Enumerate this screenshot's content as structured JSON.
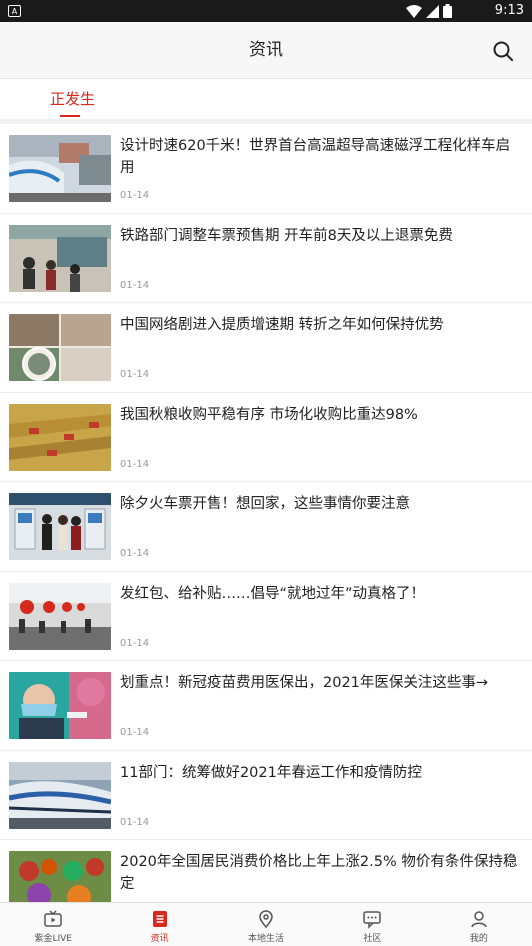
{
  "status_bar": {
    "time": "9:13",
    "app_icon_letter": "A"
  },
  "header": {
    "title": "资讯"
  },
  "tabs": [
    {
      "label": "正发生",
      "active": true
    }
  ],
  "articles": [
    {
      "title": "设计时速620千米！世界首台高温超导高速磁浮工程化样车启用",
      "date": "01-14",
      "image": "maglev-train-photo"
    },
    {
      "title": "铁路部门调整车票预售期 开车前8天及以上退票免费",
      "date": "01-14",
      "image": "ticket-hall-photo"
    },
    {
      "title": "中国网络剧进入提质增速期 转折之年如何保持优势",
      "date": "01-14",
      "image": "drama-collage-photo"
    },
    {
      "title": "我国秋粮收购平稳有序 市场化收购比重达98%",
      "date": "01-14",
      "image": "harvest-field-photo"
    },
    {
      "title": "除夕火车票开售！想回家，这些事情你要注意",
      "date": "01-14",
      "image": "ticket-machines-photo"
    },
    {
      "title": "发红包、给补贴……倡导“就地过年”动真格了！",
      "date": "01-14",
      "image": "red-lanterns-station-photo"
    },
    {
      "title": "划重点！新冠疫苗费用医保出，2021年医保关注这些事→",
      "date": "01-14",
      "image": "vaccination-photo"
    },
    {
      "title": "11部门：统筹做好2021年春运工作和疫情防控",
      "date": "01-14",
      "image": "high-speed-train-photo"
    },
    {
      "title": "2020年全国居民消费价格比上年上涨2.5% 物价有条件保持稳定",
      "date": "",
      "image": "vegetable-market-photo"
    }
  ],
  "bottom_nav": [
    {
      "label": "紫金LIVE",
      "icon": "tv-play-icon",
      "active": false
    },
    {
      "label": "资讯",
      "icon": "news-list-icon",
      "active": true
    },
    {
      "label": "本地生活",
      "icon": "location-pin-icon",
      "active": false
    },
    {
      "label": "社区",
      "icon": "chat-bubble-icon",
      "active": false
    },
    {
      "label": "我的",
      "icon": "person-icon",
      "active": false
    }
  ],
  "colors": {
    "accent": "#d8281c",
    "header_bg": "#f7f7f7",
    "text": "#222222",
    "date": "#999999"
  }
}
